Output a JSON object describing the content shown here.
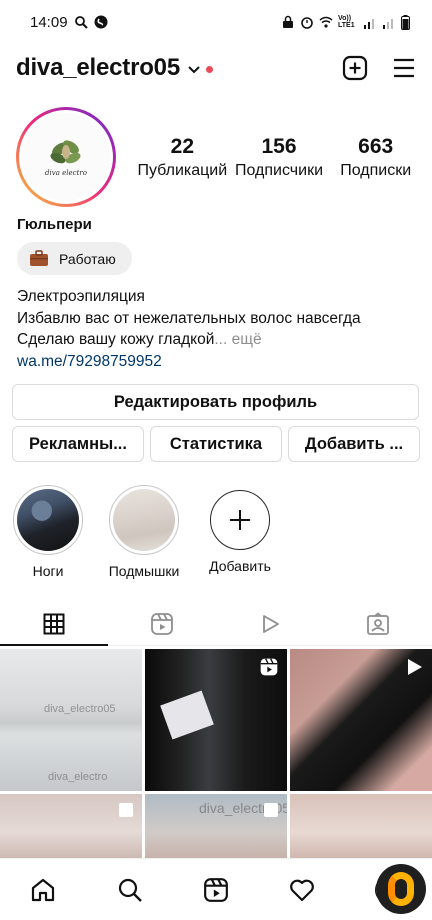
{
  "status_bar": {
    "time": "14:09",
    "network_label": "Vo)) LTE1"
  },
  "header": {
    "username": "diva_electro05",
    "accent_dot_color": "#ed4956"
  },
  "profile": {
    "avatar_logo_text": "diva electro",
    "stats": [
      {
        "count": "22",
        "label": "Публикаций"
      },
      {
        "count": "156",
        "label": "Подписчики"
      },
      {
        "count": "663",
        "label": "Подписки"
      }
    ],
    "display_name": "Гюльпери",
    "category": "Работаю",
    "bio_lines": [
      "Электроэпиляция",
      "Избавлю вас от нежелательных волос навсегда",
      "Сделаю вашу кожу гладкой"
    ],
    "bio_more": "... ещё",
    "link": "wa.me/79298759952"
  },
  "buttons": {
    "edit_profile": "Редактировать профиль",
    "ads": "Рекламны...",
    "insights": "Статистика",
    "add": "Добавить ..."
  },
  "highlights": [
    {
      "label": "Ноги",
      "icon": "legs-highlight"
    },
    {
      "label": "Подмышки",
      "icon": "underarm-highlight"
    },
    {
      "label": "Добавить",
      "icon": "plus-icon"
    }
  ],
  "tabs": [
    "grid-icon",
    "reels-icon",
    "video-icon",
    "tagged-icon"
  ],
  "grid": {
    "watermark": "diva_electro05",
    "watermark_secondary": "diva_electro"
  },
  "bottom_nav": [
    "home-icon",
    "search-icon",
    "reels-icon",
    "heart-icon",
    "profile-avatar"
  ]
}
